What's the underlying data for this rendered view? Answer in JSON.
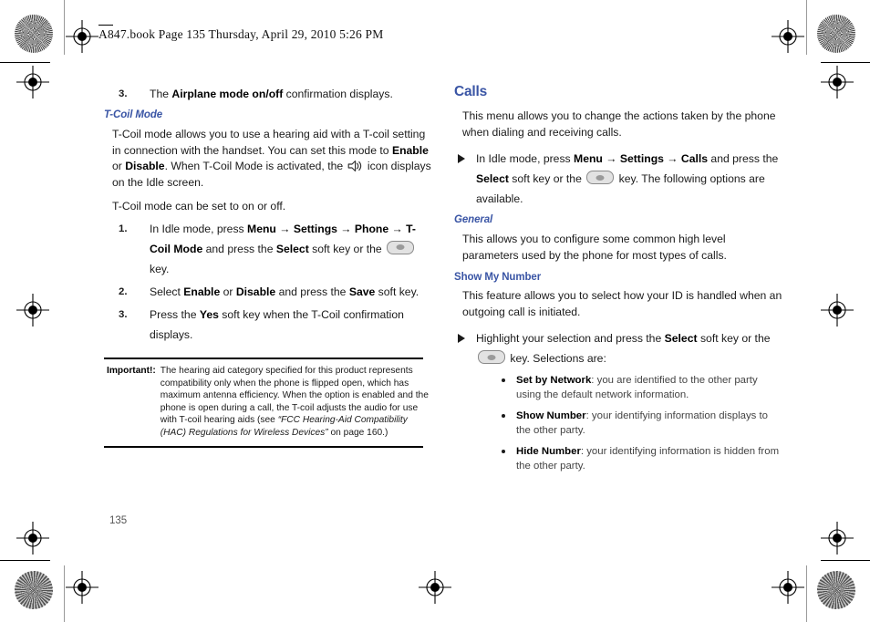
{
  "page": {
    "header": "A847.book  Page 135  Thursday, April 29, 2010  5:26 PM",
    "page_number": "135",
    "accent_color": "#3a55a5"
  },
  "left_column": {
    "step3_top": {
      "num": "3.",
      "pre": "The ",
      "bold": "Airplane mode on/off",
      "post": " confirmation displays."
    },
    "tcoil_heading": "T-Coil Mode",
    "tcoil_intro": {
      "p1": "T-Coil mode allows you to use a hearing aid with a T-coil setting in connection with the handset. You can set this mode to ",
      "b1": "Enable",
      "p2": " or ",
      "b2": "Disable",
      "p3": ". When T-Coil Mode is activated, the ",
      "icon": "speaker-icon",
      "p4": " icon displays on the Idle screen."
    },
    "tcoil_lead": "T-Coil mode can be set to on or off.",
    "steps": [
      {
        "num": "1.",
        "p1": "In Idle mode, press ",
        "b1": "Menu",
        "a1": " → ",
        "b2": "Settings",
        "a2": " → ",
        "b3": "Phone",
        "a3": " → ",
        "b4": "T-Coil Mode",
        "p2": " and press the ",
        "b5": "Select",
        "p3": " soft key or the ",
        "icon": "ok-key-icon",
        "p4": " key."
      },
      {
        "num": "2.",
        "p1": "Select ",
        "b1": "Enable",
        "p2": " or ",
        "b2": "Disable",
        "p3": " and press the ",
        "b3": "Save",
        "p4": " soft key."
      },
      {
        "num": "3.",
        "p1": "Press the ",
        "b1": "Yes",
        "p2": " soft key when the T-Coil confirmation displays."
      }
    ],
    "note": {
      "label": "Important!:",
      "text_1": "The hearing aid category specified for this product represents compatibility only when the phone is flipped open, which has maximum antenna efficiency. When the option is enabled and the phone is open during a call, the T-coil adjusts the audio for use with T-coil hearing aids (see ",
      "italic": "“FCC Hearing-Aid Compatibility (HAC) Regulations for Wireless Devices”",
      "text_2": " on page 160.)"
    }
  },
  "right_column": {
    "calls_heading": "Calls",
    "calls_intro": "This menu allows you to change the actions taken by the phone when dialing and receiving calls.",
    "calls_bullet": {
      "p1": "In Idle mode, press ",
      "b1": "Menu",
      "a1": " → ",
      "b2": "Settings",
      "a2": " → ",
      "b3": "Calls",
      "p2": " and press the ",
      "b4": "Select",
      "p3": " soft key or the ",
      "icon": "ok-key-icon",
      "p4": " key. The following options are available."
    },
    "general_heading": "General",
    "general_text": "This allows you to configure some common high level parameters used by the phone for most types of calls.",
    "show_my_number_heading": "Show My Number",
    "show_my_number_text": "This feature allows you to select how your ID is handled when an outgoing call is initiated.",
    "show_my_number_bullet": {
      "p1": "Highlight your selection and press the ",
      "b1": "Select",
      "p2": " soft key or the ",
      "icon": "ok-key-icon",
      "p3": " key. Selections are:"
    },
    "options": [
      {
        "label": "Set by Network",
        "desc": ": you are identified to the other party using the default network information."
      },
      {
        "label": "Show Number",
        "desc": ": your identifying information displays to the other party."
      },
      {
        "label": "Hide Number",
        "desc": ": your identifying information is hidden from the other party."
      }
    ]
  }
}
